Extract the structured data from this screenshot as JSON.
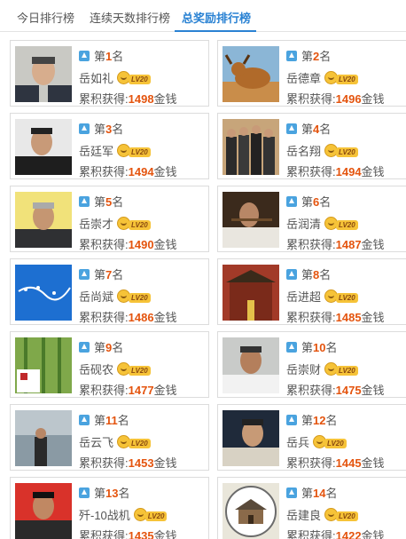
{
  "tabs": [
    {
      "label": "今日排行榜"
    },
    {
      "label": "连续天数排行榜"
    },
    {
      "label": "总奖励排行榜"
    }
  ],
  "labels": {
    "rank_prefix": "第",
    "rank_suffix": "名",
    "earn_prefix": "累积获得:",
    "earn_suffix": "金钱",
    "level_text": "LV20"
  },
  "entries": [
    {
      "rank": "1",
      "name": "岳如礼",
      "total": "1498"
    },
    {
      "rank": "2",
      "name": "岳德章",
      "total": "1496"
    },
    {
      "rank": "3",
      "name": "岳廷军",
      "total": "1494"
    },
    {
      "rank": "4",
      "name": "岳名翔",
      "total": "1494"
    },
    {
      "rank": "5",
      "name": "岳崇才",
      "total": "1490"
    },
    {
      "rank": "6",
      "name": "岳润清",
      "total": "1487"
    },
    {
      "rank": "7",
      "name": "岳尚斌",
      "total": "1486"
    },
    {
      "rank": "8",
      "name": "岳进超",
      "total": "1485"
    },
    {
      "rank": "9",
      "name": "岳砚农",
      "total": "1477"
    },
    {
      "rank": "10",
      "name": "岳崇财",
      "total": "1475"
    },
    {
      "rank": "11",
      "name": "岳云飞",
      "total": "1453"
    },
    {
      "rank": "12",
      "name": "岳兵",
      "total": "1445"
    },
    {
      "rank": "13",
      "name": "歼-10战机",
      "total": "1435"
    },
    {
      "rank": "14",
      "name": "岳建良",
      "total": "1422"
    }
  ],
  "colors": {
    "accent": "#2a82d3",
    "highlight": "#e4540e"
  }
}
